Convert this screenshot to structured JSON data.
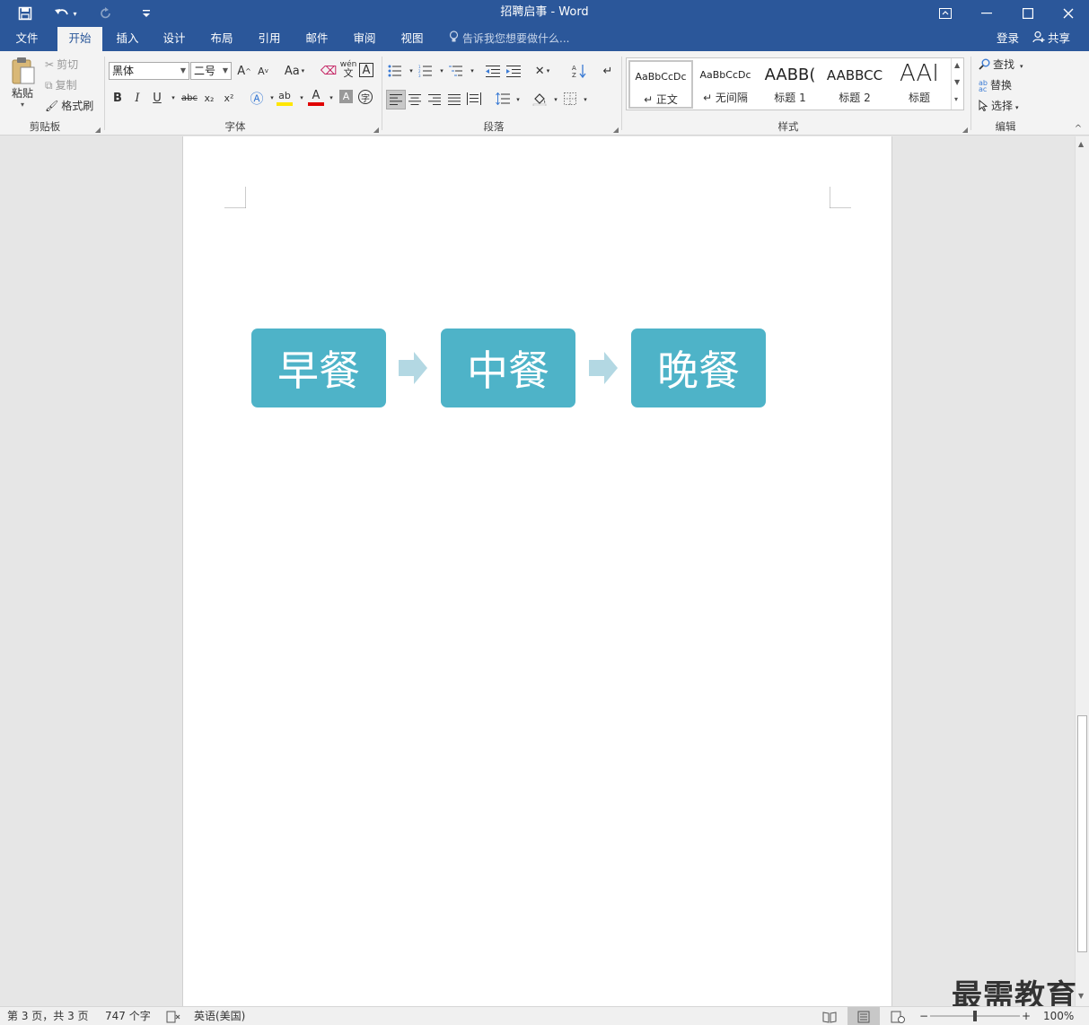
{
  "window": {
    "title": "招聘启事 - Word",
    "colors": {
      "accent": "#2b579a",
      "shape_fill": "#4eb3c8",
      "arrow_fill": "#b3d8e3"
    }
  },
  "quick_access": {
    "save_icon": "save-icon",
    "undo_icon": "undo-icon",
    "redo_icon": "redo-icon",
    "customize_icon": "customize-icon"
  },
  "tabs": [
    {
      "label": "文件"
    },
    {
      "label": "开始"
    },
    {
      "label": "插入"
    },
    {
      "label": "设计"
    },
    {
      "label": "布局"
    },
    {
      "label": "引用"
    },
    {
      "label": "邮件"
    },
    {
      "label": "审阅"
    },
    {
      "label": "视图"
    }
  ],
  "tell_me": "告诉我您想要做什么...",
  "account": {
    "login": "登录",
    "share": "共享"
  },
  "ribbon": {
    "clipboard": {
      "paste": "粘贴",
      "cut": "剪切",
      "copy": "复制",
      "format_painter": "格式刷",
      "label": "剪贴板"
    },
    "font": {
      "font_name": "黑体",
      "font_size": "二号",
      "case": "Aa",
      "bold": "B",
      "italic": "I",
      "underline": "U",
      "strike": "abc",
      "subscript": "x₂",
      "superscript": "x²",
      "phonetic": "wén",
      "phonetic2": "文",
      "border_char": "A",
      "shade_char": "A",
      "enclose": "字",
      "label": "字体"
    },
    "paragraph": {
      "label": "段落"
    },
    "styles": {
      "label": "样式",
      "items": [
        {
          "preview": "AaBbCcDc",
          "name": "↵ 正文"
        },
        {
          "preview": "AaBbCcDc",
          "name": "↵ 无间隔"
        },
        {
          "preview": "AABB(",
          "name": "标题 1"
        },
        {
          "preview": "AABBCC",
          "name": "标题 2"
        },
        {
          "preview": "AAI",
          "name": "标题"
        }
      ]
    },
    "editing": {
      "find": "查找",
      "replace": "替换",
      "select": "选择",
      "label": "编辑"
    }
  },
  "document": {
    "process": [
      {
        "text": "早餐"
      },
      {
        "text": "中餐"
      },
      {
        "text": "晚餐"
      }
    ]
  },
  "status": {
    "page": "第 3 页，共 3 页",
    "words": "747 个字",
    "language": "英语(美国)",
    "zoom": "100%",
    "zoom_level": 1.0
  },
  "watermark": "最需教育"
}
